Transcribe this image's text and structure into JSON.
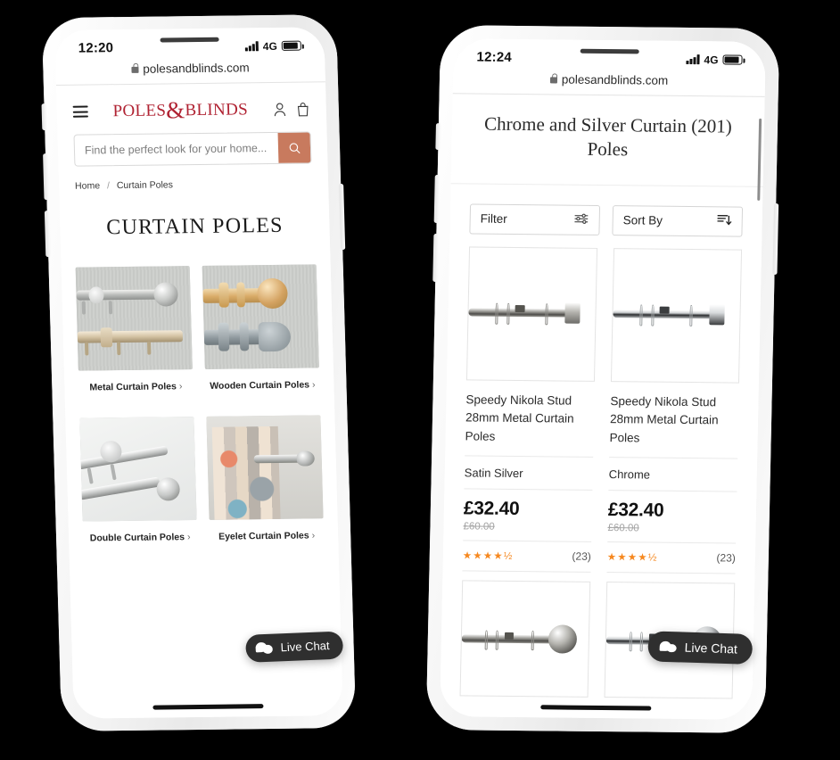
{
  "background_color": "#000000",
  "brand": {
    "name_part1": "POLES",
    "ampersand": "&",
    "name_part2": "BLINDS",
    "logo_color": "#b02232",
    "accent_color": "#c87a5e",
    "star_color": "#f6881f"
  },
  "left_phone": {
    "status_bar": {
      "time": "12:20",
      "network": "4G"
    },
    "url_bar": {
      "url": "polesandblinds.com",
      "lock": "lock-icon"
    },
    "header": {
      "menu_icon": "hamburger-menu-icon",
      "account_icon": "user-account-icon",
      "bag_icon": "shopping-bag-icon"
    },
    "search": {
      "placeholder": "Find the perfect look for your home...",
      "value": "",
      "button_icon": "search-icon"
    },
    "breadcrumb": {
      "home": "Home",
      "separator": "/",
      "current": "Curtain Poles"
    },
    "page_title": "CURTAIN POLES",
    "categories": [
      {
        "label": "Metal Curtain Poles",
        "chevron": "›"
      },
      {
        "label": "Wooden Curtain Poles",
        "chevron": "›"
      },
      {
        "label": "Double Curtain Poles",
        "chevron": "›"
      },
      {
        "label": "Eyelet Curtain Poles",
        "chevron": "›"
      }
    ],
    "live_chat": {
      "label": "Live Chat",
      "icon": "chat-bubble-icon"
    }
  },
  "right_phone": {
    "status_bar": {
      "time": "12:24",
      "network": "4G"
    },
    "url_bar": {
      "url": "polesandblinds.com",
      "lock": "lock-icon"
    },
    "page_title": "Chrome and Silver Curtain (201) Poles",
    "controls": {
      "filter_label": "Filter",
      "filter_icon": "filter-sliders-icon",
      "sort_label": "Sort By",
      "sort_icon": "sort-descending-icon"
    },
    "products": [
      {
        "name": "Speedy Nikola Stud 28mm Metal Curtain Poles",
        "colour": "Satin Silver",
        "price": "£32.40",
        "was_price": "£60.00",
        "stars": "★★★★½",
        "rating_value": 4.5,
        "review_count": "(23)",
        "image": "satin-silver-stud-end-curtain-pole"
      },
      {
        "name": "Speedy Nikola Stud 28mm Metal Curtain Poles",
        "colour": "Chrome",
        "price": "£32.40",
        "was_price": "£60.00",
        "stars": "★★★★½",
        "rating_value": 4.5,
        "review_count": "(23)",
        "image": "chrome-stud-end-curtain-pole"
      },
      {
        "name": "",
        "colour": "",
        "price": "",
        "was_price": "",
        "stars": "",
        "review_count": "",
        "image": "satin-silver-ball-end-curtain-pole"
      },
      {
        "name": "",
        "colour": "",
        "price": "",
        "was_price": "",
        "stars": "",
        "review_count": "",
        "image": "chrome-ball-end-curtain-pole"
      }
    ],
    "live_chat": {
      "label": "Live Chat",
      "icon": "chat-bubble-icon"
    }
  }
}
